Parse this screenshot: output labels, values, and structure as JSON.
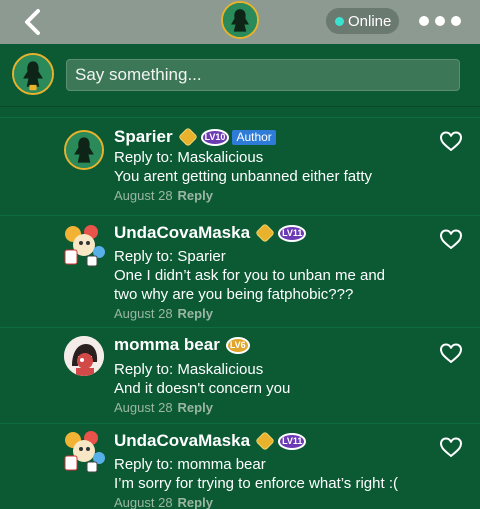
{
  "header": {
    "status": "Online"
  },
  "composer": {
    "placeholder": "Say something..."
  },
  "comments": [
    {
      "name": "Sparier",
      "level": "LV10",
      "author_tag": "Author",
      "reply_prefix": "Reply to: ",
      "reply_to": "Maskalicious",
      "lines": [
        "You arent getting unbanned either fatty"
      ],
      "date": "August 28",
      "reply_label": "Reply"
    },
    {
      "name": "UndaCovaMaska",
      "level": "LV11",
      "reply_prefix": "Reply to: ",
      "reply_to": "Sparier",
      "lines": [
        "One I didn’t ask for you to unban me and",
        "two why are you being fatphobic???"
      ],
      "date": "August 28",
      "reply_label": "Reply"
    },
    {
      "name": "momma bear",
      "level": "LV6",
      "reply_prefix": "Reply to: ",
      "reply_to": "Maskalicious",
      "lines": [
        "And it doesn't concern you"
      ],
      "date": "August 28",
      "reply_label": "Reply"
    },
    {
      "name": "UndaCovaMaska",
      "level": "LV11",
      "reply_prefix": "Reply to: ",
      "reply_to": "momma bear",
      "lines": [
        "I’m sorry for trying to enforce what’s right :("
      ],
      "date": "August 28",
      "reply_label": "Reply"
    }
  ],
  "colors": {
    "background": "#0b5a34",
    "header": "#8d9a91",
    "accent_gold": "#e8b22c",
    "author_blue": "#2f7bd8",
    "level_purple": "#6c3bb4",
    "online_dot": "#3be2d0"
  },
  "icons": [
    "back-icon",
    "more-icon",
    "heart-icon",
    "gold-badge-icon",
    "level-badge-icon"
  ]
}
